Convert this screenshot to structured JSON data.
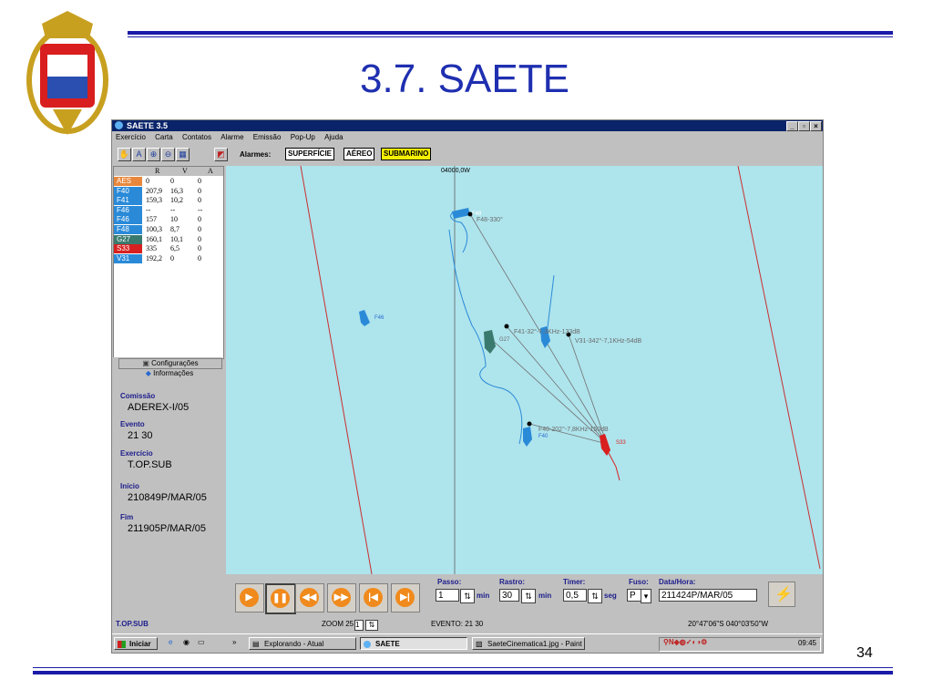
{
  "slide": {
    "title": "3.7. SAETE",
    "page_number": "34"
  },
  "window": {
    "title": "SAETE 3.5"
  },
  "menu": [
    "Exercício",
    "Carta",
    "Contatos",
    "Alarme",
    "Emissão",
    "Pop-Up",
    "Ajuda"
  ],
  "toolbar": {
    "alarms_label": "Alarmes:",
    "alarm_buttons": [
      "SUPERFÍCIE",
      "AÉREO",
      "SUBMARINO"
    ]
  },
  "contacts_table": {
    "headers": [
      "R",
      "V",
      "A"
    ],
    "rows": [
      {
        "code": "AES",
        "r": "0",
        "v": "0",
        "a": "0",
        "color": "#e8873c"
      },
      {
        "code": "F40",
        "r": "207,9",
        "v": "16,3",
        "a": "0",
        "color": "#2a8ad8"
      },
      {
        "code": "F41",
        "r": "159,3",
        "v": "10,2",
        "a": "0",
        "color": "#2a8ad8"
      },
      {
        "code": "F46",
        "r": "--",
        "v": "--",
        "a": "--",
        "color": "#2a8ad8"
      },
      {
        "code": "F46",
        "r": "157",
        "v": "10",
        "a": "0",
        "color": "#2a8ad8"
      },
      {
        "code": "F48",
        "r": "100,3",
        "v": "8,7",
        "a": "0",
        "color": "#2a8ad8"
      },
      {
        "code": "G27",
        "r": "160,1",
        "v": "10,1",
        "a": "0",
        "color": "#3a7a6e"
      },
      {
        "code": "S33",
        "r": "335",
        "v": "6,5",
        "a": "0",
        "color": "#d82020"
      },
      {
        "code": "V31",
        "r": "192,2",
        "v": "0",
        "a": "0",
        "color": "#2a8ad8"
      }
    ]
  },
  "info": {
    "tabs": [
      "Configurações",
      "Informações"
    ],
    "fields": [
      {
        "label": "Comissão",
        "value": "ADEREX-I/05"
      },
      {
        "label": "Evento",
        "value": "21 30"
      },
      {
        "label": "Exercício",
        "value": "T.OP.SUB"
      },
      {
        "label": "Início",
        "value": "210849P/MAR/05"
      },
      {
        "label": "Fim",
        "value": "211905P/MAR/05"
      }
    ]
  },
  "map": {
    "meridian_label": "04000,0W",
    "labels": {
      "f48": "F48",
      "f48_bearing": "F48-330°",
      "f46": "F46",
      "f41": "F41-32°-7,3KHz-133dB",
      "g27": "G27",
      "v31": "V31-342°-7,1KHz-54dB",
      "f40": "F40-202°-7,8KHz-150dB",
      "f40_ship": "F40",
      "s33": "S33"
    }
  },
  "controls": {
    "passo": {
      "label": "Passo:",
      "value": "1",
      "unit": "min"
    },
    "rastro": {
      "label": "Rastro:",
      "value": "30",
      "unit": "min"
    },
    "timer": {
      "label": "Timer:",
      "value": "0,5",
      "unit": "seg"
    },
    "fuso": {
      "label": "Fuso:",
      "value": "P"
    },
    "datahora": {
      "label": "Data/Hora:",
      "value": "211424P/MAR/05"
    }
  },
  "status": {
    "mode": "T.OP.SUB",
    "zoom_label": "ZOOM 25",
    "zoom_value": "1",
    "evento": "EVENTO: 21 30",
    "coords": "20°47'06\"S 040°03'50\"W"
  },
  "taskbar": {
    "start": "Iniciar",
    "tasks": [
      "Explorando - Atual",
      "SAETE",
      "SaeteCinematica1.jpg - Paint"
    ],
    "clock": "09:45"
  }
}
